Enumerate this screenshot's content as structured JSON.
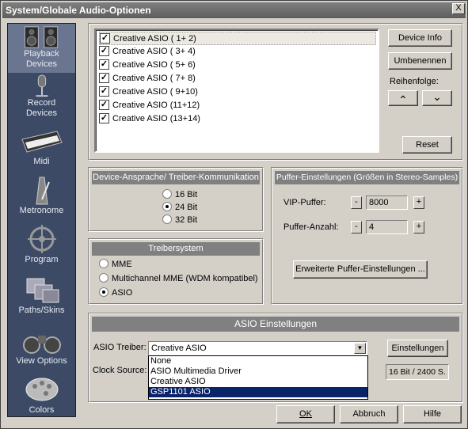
{
  "window": {
    "title": "System/Globale Audio-Optionen",
    "close_glyph": "X"
  },
  "sidebar": {
    "items": [
      {
        "label_line1": "Playback",
        "label_line2": "Devices",
        "icon": "speakers-icon",
        "active": true
      },
      {
        "label_line1": "Record",
        "label_line2": "Devices",
        "icon": "microphone-icon",
        "active": false
      },
      {
        "label_line1": "Midi",
        "label_line2": "",
        "icon": "keyboard-icon",
        "active": false
      },
      {
        "label_line1": "Metronome",
        "label_line2": "",
        "icon": "metronome-icon",
        "active": false
      },
      {
        "label_line1": "Program",
        "label_line2": "",
        "icon": "ship-wheel-icon",
        "active": false
      },
      {
        "label_line1": "Paths/Skins",
        "label_line2": "",
        "icon": "folders-icon",
        "active": false
      },
      {
        "label_line1": "View Options",
        "label_line2": "",
        "icon": "binoculars-icon",
        "active": false
      },
      {
        "label_line1": "Colors",
        "label_line2": "",
        "icon": "palette-icon",
        "active": false
      }
    ]
  },
  "devices": {
    "list": [
      {
        "label": "Creative ASIO ( 1+ 2)",
        "checked": true,
        "selected": true
      },
      {
        "label": "Creative ASIO ( 3+ 4)",
        "checked": true,
        "selected": false
      },
      {
        "label": "Creative ASIO ( 5+ 6)",
        "checked": true,
        "selected": false
      },
      {
        "label": "Creative ASIO ( 7+ 8)",
        "checked": true,
        "selected": false
      },
      {
        "label": "Creative ASIO ( 9+10)",
        "checked": true,
        "selected": false
      },
      {
        "label": "Creative ASIO (11+12)",
        "checked": true,
        "selected": false
      },
      {
        "label": "Creative ASIO (13+14)",
        "checked": true,
        "selected": false
      }
    ],
    "check_glyph": "✓",
    "device_info_label": "Device Info",
    "rename_label": "Umbenennen",
    "order_label": "Reihenfolge:",
    "up_glyph": "⌃",
    "down_glyph": "⌄",
    "reset_label": "Reset"
  },
  "bitdepth": {
    "title": "Device-Ansprache/ Treiber-Kommunikation",
    "options": [
      {
        "label": "16 Bit",
        "on": false
      },
      {
        "label": "24 Bit",
        "on": true
      },
      {
        "label": "32 Bit",
        "on": false
      }
    ]
  },
  "driver": {
    "title": "Treibersystem",
    "options": [
      {
        "label": "MME",
        "on": false
      },
      {
        "label": "Multichannel MME (WDM kompatibel)",
        "on": false
      },
      {
        "label": "ASIO",
        "on": true
      }
    ]
  },
  "buffer": {
    "title": "Puffer-Einstellungen (Größen in Stereo-Samples)",
    "vip_label": "VIP-Puffer:",
    "vip_value": "8000",
    "count_label": "Puffer-Anzahl:",
    "count_value": "4",
    "minus": "-",
    "plus": "+",
    "advanced_label": "Erweiterte Puffer-Einstellungen ..."
  },
  "asio": {
    "title": "ASIO Einstellungen",
    "driver_label": "ASIO Treiber:",
    "driver_value": "Creative ASIO",
    "combo_arrow": "▼",
    "clock_label": "Clock Source:",
    "settings_label": "Einstellungen",
    "format_value": "16 Bit / 2400 S.",
    "dropdown_options": [
      {
        "label": "None",
        "selected": false
      },
      {
        "label": "ASIO Multimedia Driver",
        "selected": false
      },
      {
        "label": "Creative ASIO",
        "selected": false
      },
      {
        "label": "GSP1101 ASIO",
        "selected": true
      }
    ]
  },
  "footer": {
    "ok_label": "OK",
    "cancel_label": "Abbruch",
    "help_label": "Hilfe"
  }
}
